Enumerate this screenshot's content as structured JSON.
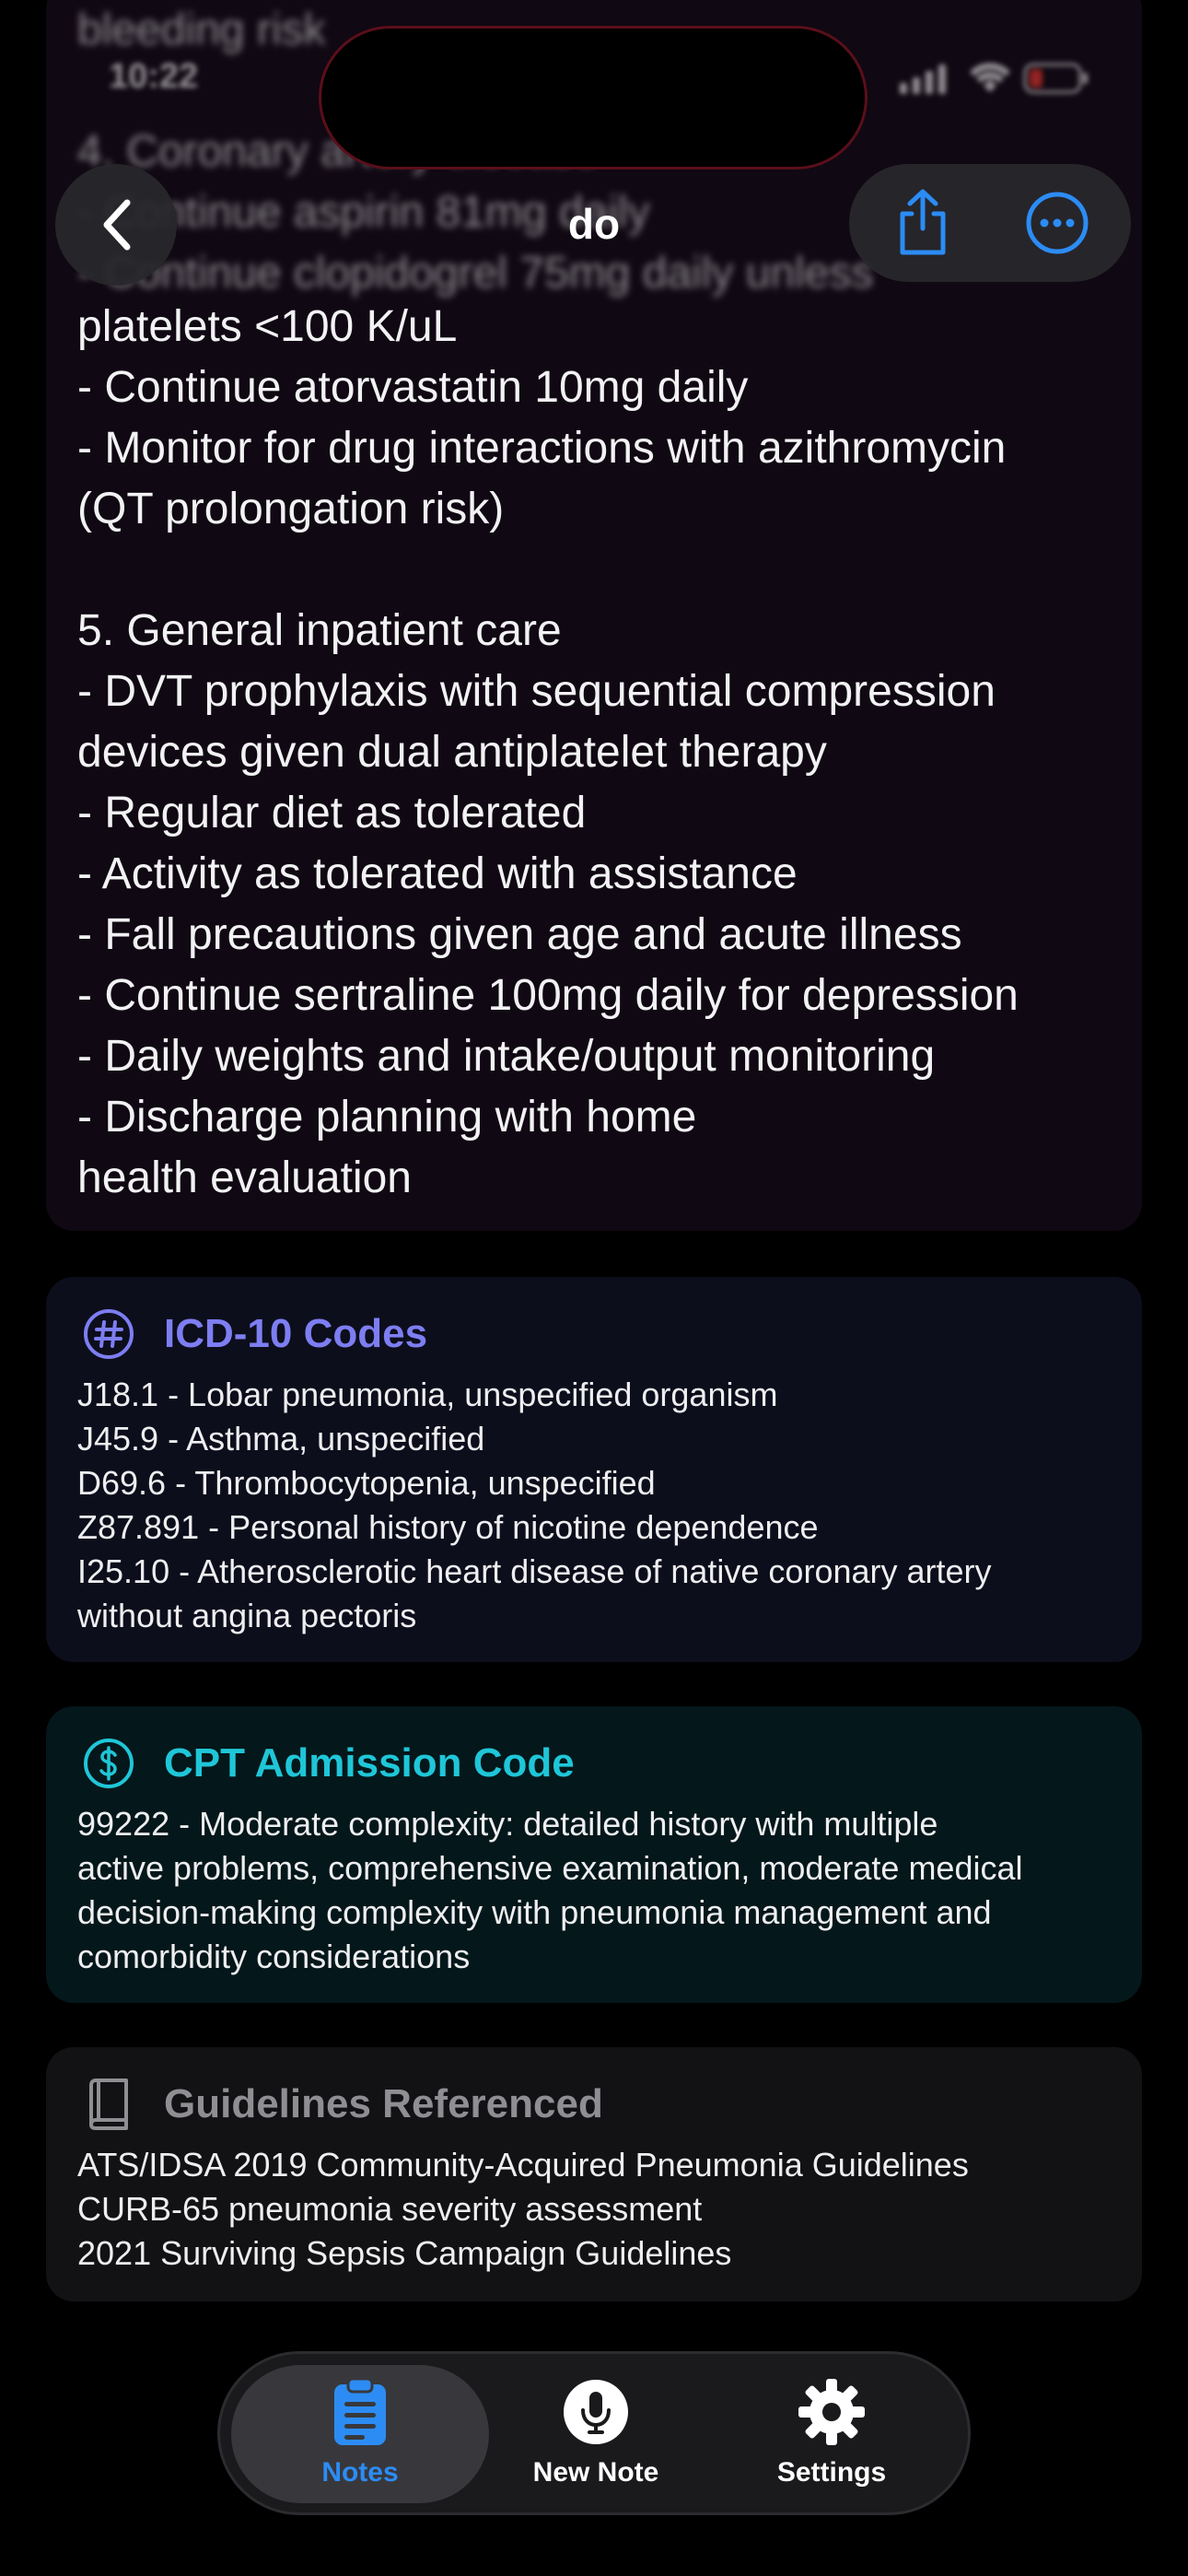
{
  "status_bar": {
    "time": "10:22"
  },
  "header": {
    "title": "do",
    "back_icon": "chevron-left-icon",
    "share_icon": "share-icon",
    "more_icon": "ellipsis-circle-icon",
    "accent_color": "#2c8cf4"
  },
  "plan": {
    "faded_lines": [
      "bleeding risk",
      "",
      "4. Coronary artery disease",
      "- Continue aspirin 81mg daily",
      "- Continue clopidogrel 75mg daily unless"
    ],
    "lines": [
      "platelets <100 K/uL",
      "- Continue atorvastatin 10mg daily",
      "- Monitor for drug interactions with azithromycin",
      "(QT prolongation risk)",
      "",
      "5. General inpatient care",
      "- DVT prophylaxis with sequential compression",
      "devices given dual antiplatelet therapy",
      "- Regular diet as tolerated",
      "- Activity as tolerated with assistance",
      "- Fall precautions given age and acute illness",
      "- Continue sertraline 100mg daily for depression",
      "- Daily weights and intake/output monitoring",
      "- Discharge planning with home",
      "health evaluation"
    ]
  },
  "icd": {
    "title": "ICD-10 Codes",
    "icon": "hashtag-circle-icon",
    "color": "#7d7ef2",
    "lines": [
      "J18.1 - Lobar pneumonia, unspecified organism",
      "J45.9 - Asthma, unspecified",
      "D69.6 - Thrombocytopenia, unspecified",
      "Z87.891 - Personal history of nicotine dependence",
      "I25.10 - Atherosclerotic heart disease of native coronary artery",
      "without angina pectoris"
    ]
  },
  "cpt": {
    "title": "CPT Admission Code",
    "icon": "dollar-circle-icon",
    "color": "#1fc6d8",
    "lines": [
      "99222 - Moderate complexity: detailed history with multiple",
      "active problems, comprehensive examination, moderate medical",
      "decision-making complexity with pneumonia management and",
      "comorbidity considerations"
    ]
  },
  "guidelines": {
    "title": "Guidelines Referenced",
    "icon": "book-icon",
    "color": "#8e8e93",
    "lines": [
      "ATS/IDSA 2019 Community-Acquired Pneumonia Guidelines",
      "CURB-65 pneumonia severity assessment",
      "2021 Surviving Sepsis Campaign Guidelines"
    ]
  },
  "tabbar": {
    "active_color": "#2c8cf4",
    "tabs": [
      {
        "label": "Notes",
        "icon": "clipboard-icon",
        "active": true
      },
      {
        "label": "New Note",
        "icon": "microphone-icon",
        "active": false
      },
      {
        "label": "Settings",
        "icon": "gear-icon",
        "active": false
      }
    ]
  }
}
